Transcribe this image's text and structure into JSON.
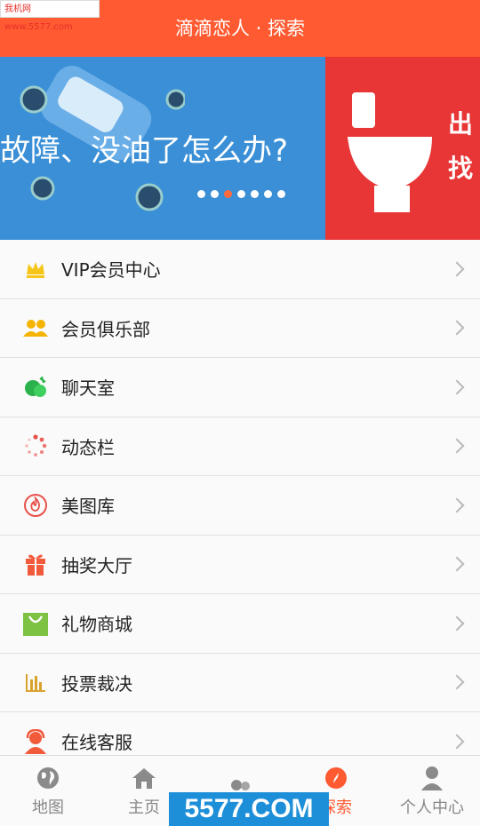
{
  "watermark_top": "我机网 www.5577.com",
  "header": {
    "title": "滴滴恋人 · 探索"
  },
  "banner": {
    "slide1_caption": "故障、没油了怎么办?",
    "slide2_line1": "出",
    "slide2_line2": "找",
    "dot_count": 7,
    "active_dot": 2
  },
  "menu": [
    {
      "label": "VIP会员中心",
      "icon": "crown-icon",
      "color": "#f5c518"
    },
    {
      "label": "会员俱乐部",
      "icon": "group-icon",
      "color": "#f5b400"
    },
    {
      "label": "聊天室",
      "icon": "chat-icon",
      "color": "#2bb24c"
    },
    {
      "label": "动态栏",
      "icon": "spinner-icon",
      "color": "#e8504a"
    },
    {
      "label": "美图库",
      "icon": "flame-icon",
      "color": "#e8504a"
    },
    {
      "label": "抽奖大厅",
      "icon": "gift-icon",
      "color": "#f25a3c"
    },
    {
      "label": "礼物商城",
      "icon": "shopping-bag-icon",
      "color": "#7dc242"
    },
    {
      "label": "投票裁决",
      "icon": "bar-chart-icon",
      "color": "#d9a22b"
    },
    {
      "label": "在线客服",
      "icon": "support-agent-icon",
      "color": "#f25a3c"
    }
  ],
  "tabs": [
    {
      "label": "地图",
      "icon": "globe-icon"
    },
    {
      "label": "主页",
      "icon": "home-icon"
    },
    {
      "label": "",
      "icon": "users-icon"
    },
    {
      "label": "探索",
      "icon": "compass-icon"
    },
    {
      "label": "个人中心",
      "icon": "person-icon"
    }
  ],
  "watermark_bottom": "5577.COM"
}
